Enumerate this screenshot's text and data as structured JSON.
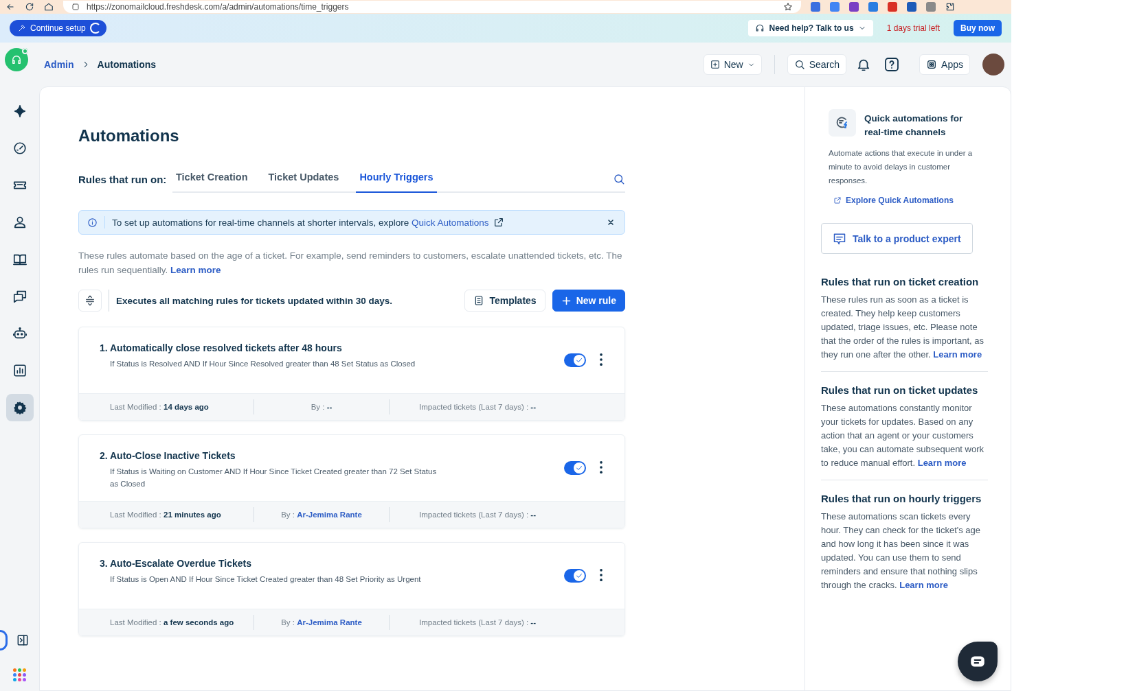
{
  "browser": {
    "url": "https://zonomailcloud.freshdesk.com/a/admin/automations/time_triggers"
  },
  "banner": {
    "setup_button": "Continue setup",
    "help": "Need help? Talk to us",
    "trial": "1 days trial left",
    "buy": "Buy now"
  },
  "header": {
    "breadcrumbs": [
      "Admin",
      "Automations"
    ],
    "new_button": "New",
    "search": "Search",
    "apps": "Apps"
  },
  "sidebar": {
    "items": [
      {
        "kind": "sparkle",
        "selected": false
      },
      {
        "kind": "gauge",
        "selected": false
      },
      {
        "kind": "ticket",
        "selected": false
      },
      {
        "kind": "person",
        "selected": false
      },
      {
        "kind": "book",
        "selected": false
      },
      {
        "kind": "chat",
        "selected": false
      },
      {
        "kind": "bot",
        "selected": false
      },
      {
        "kind": "report",
        "selected": false
      },
      {
        "kind": "gear",
        "selected": true
      }
    ]
  },
  "page": {
    "title": "Automations",
    "tabs_label": "Rules that run on:",
    "tabs": [
      {
        "label": "Ticket Creation",
        "selected": false
      },
      {
        "label": "Ticket Updates",
        "selected": false
      },
      {
        "label": "Hourly Triggers",
        "selected": true
      }
    ],
    "notice": {
      "text": "To set up automations for real-time channels at shorter intervals, explore",
      "link": "Quick Automations"
    },
    "description": "These rules automate based on the age of a ticket. For example, send reminders to customers, escalate unattended tickets, etc. The rules run sequentially.",
    "learn_more": "Learn more",
    "toolbar": {
      "info": "Executes all matching rules for tickets updated within 30 days.",
      "templates": "Templates",
      "new_rule": "New rule"
    },
    "rules": [
      {
        "number": "1.",
        "title": "Automatically close resolved tickets after 48 hours",
        "condition": "If Status is Resolved AND If Hour Since Resolved greater than 48 Set Status as Closed",
        "enabled": true,
        "modified_label": "Last Modified :",
        "modified": "14 days ago",
        "by_label": "By :",
        "by": "--",
        "by_link": false,
        "impacted_label": "Impacted tickets (Last 7 days) :",
        "impacted": "--"
      },
      {
        "number": "2.",
        "title": "Auto-Close Inactive Tickets",
        "condition": "If Status is Waiting on Customer AND If Hour Since Ticket Created greater than 72 Set Status as Closed",
        "enabled": true,
        "modified_label": "Last Modified :",
        "modified": "21 minutes ago",
        "by_label": "By :",
        "by": "Ar-Jemima Rante",
        "by_link": true,
        "impacted_label": "Impacted tickets (Last 7 days) :",
        "impacted": "--"
      },
      {
        "number": "3.",
        "title": "Auto-Escalate Overdue Tickets",
        "condition": "If Status is Open AND If Hour Since Ticket Created greater than 48 Set Priority as Urgent",
        "enabled": true,
        "modified_label": "Last Modified :",
        "modified": "a few seconds ago",
        "by_label": "By :",
        "by": "Ar-Jemima Rante",
        "by_link": true,
        "impacted_label": "Impacted tickets (Last 7 days) :",
        "impacted": "--"
      }
    ]
  },
  "side_panel": {
    "quick": {
      "title": "Quick automations for real-time channels",
      "text": "Automate actions that execute in under a minute to avoid delays in customer responses.",
      "link": "Explore Quick Automations"
    },
    "expert_button": "Talk to a product expert",
    "sections": [
      {
        "title": "Rules that run on ticket creation",
        "text": "These rules run as soon as a ticket is created. They help keep customers updated, triage issues, etc. Please note that the order of the rules is important, as they run one after the other.",
        "link": "Learn more"
      },
      {
        "title": "Rules that run on ticket updates",
        "text": "These automations constantly monitor your tickets for updates. Based on any action that an agent or your customers take, you can automate subsequent work to reduce manual effort.",
        "link": "Learn more"
      },
      {
        "title": "Rules that run on hourly triggers",
        "text": "These automations scan tickets every hour. They can check for the ticket's age and how long it has been since it was updated. You can use them to send reminders and ensure that nothing slips through the cracks.",
        "link": "Learn more"
      }
    ]
  }
}
